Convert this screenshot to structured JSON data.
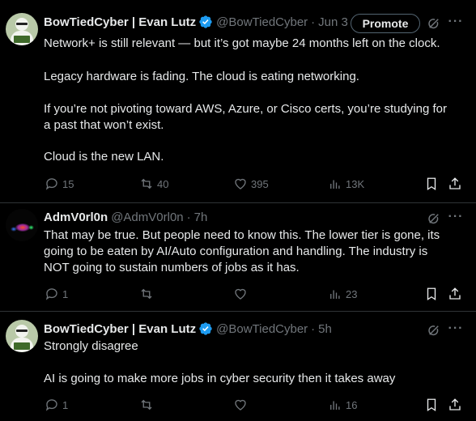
{
  "posts": [
    {
      "name": "BowTiedCyber | Evan Lutz",
      "handle": "@BowTiedCyber",
      "separator": "·",
      "time": "Jun 3",
      "promote_label": "Promote",
      "lines": [
        "Network+ is still relevant — but it’s got maybe 24 months left on the clock.",
        "Legacy hardware is fading. The cloud is eating networking.",
        "If you’re not pivoting toward AWS, Azure, or Cisco certs, you’re studying for",
        "a past that won’t exist.",
        "Cloud is the new LAN."
      ],
      "stats": {
        "replies": "15",
        "reposts": "40",
        "likes": "395",
        "views": "13K"
      }
    },
    {
      "name": "AdmV0rl0n",
      "handle": "@AdmV0rl0n",
      "separator": "·",
      "time": "7h",
      "lines": [
        "That may be true. But people need to know this. The lower tier is gone, its",
        "going to be eaten by AI/Auto configuration and handling. The industry is",
        "NOT going to sustain numbers of jobs as it has."
      ],
      "stats": {
        "replies": "1",
        "reposts": "",
        "likes": "",
        "views": "23"
      }
    },
    {
      "name": "BowTiedCyber | Evan Lutz",
      "handle": "@BowTiedCyber",
      "separator": "·",
      "time": "5h",
      "lines": [
        "Strongly disagree",
        "AI is going to make more jobs in cyber security then it takes away"
      ],
      "stats": {
        "replies": "1",
        "reposts": "",
        "likes": "",
        "views": "16"
      }
    }
  ],
  "more_label": "···",
  "icons": {
    "verified": "verified-badge-icon",
    "grok": "grok-icon",
    "more": "more-icon",
    "reply": "reply-icon",
    "repost": "repost-icon",
    "like": "heart-icon",
    "views": "views-icon",
    "bookmark": "bookmark-icon",
    "share": "share-icon"
  },
  "colors": {
    "background": "#000000",
    "text": "#e7e9ea",
    "muted": "#71767b",
    "verified": "#1d9bf0",
    "divider": "#2f3336"
  }
}
